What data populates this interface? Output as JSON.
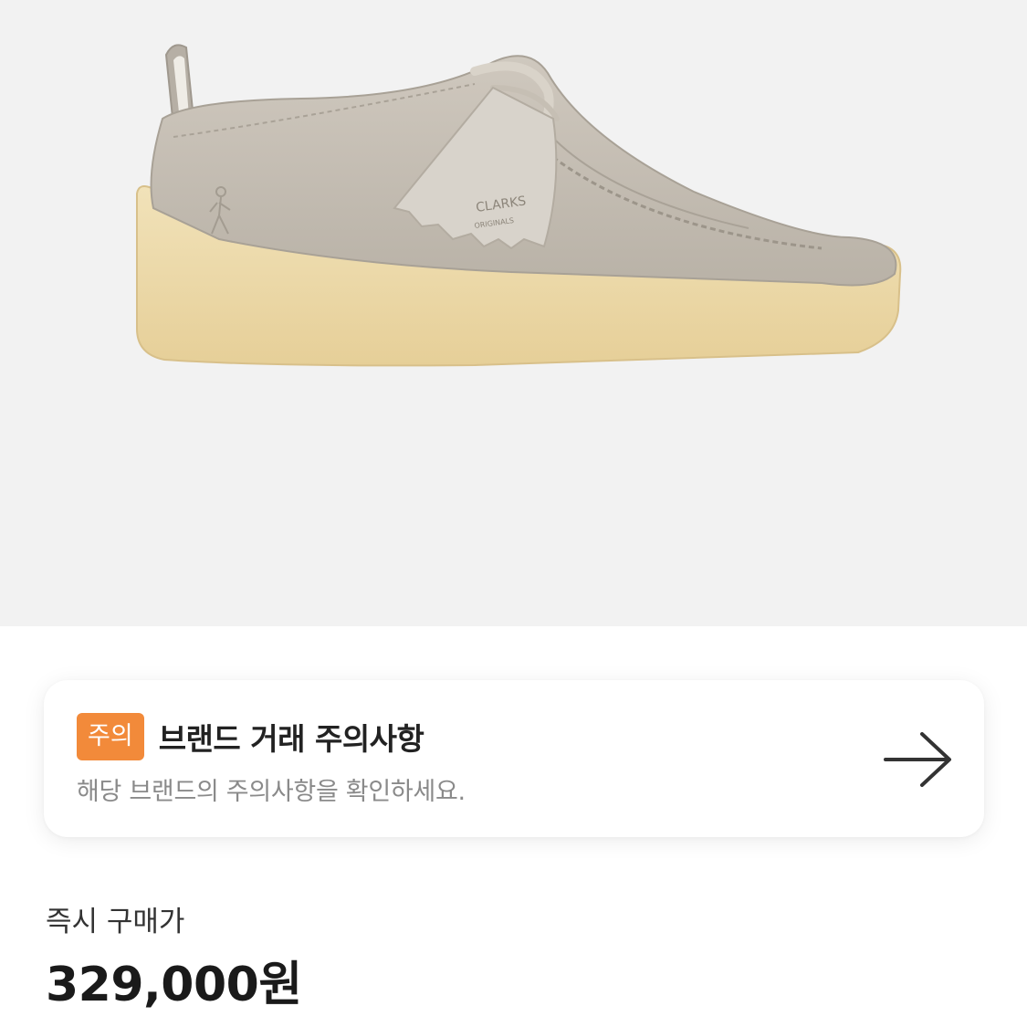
{
  "product": {
    "image_alt": "Clarks Originals suede wallabee shoe",
    "tag_text_line1": "CLARKS",
    "tag_text_line2": "ORIGINALS"
  },
  "notice": {
    "badge": "주의",
    "title": "브랜드 거래 주의사항",
    "description": "해당 브랜드의 주의사항을 확인하세요.",
    "arrow_icon": "arrow-right-icon"
  },
  "price": {
    "label": "즉시 구매가",
    "value": "329,000원"
  },
  "colors": {
    "badge_bg": "#f28a3a",
    "image_bg": "#f2f2f2"
  }
}
